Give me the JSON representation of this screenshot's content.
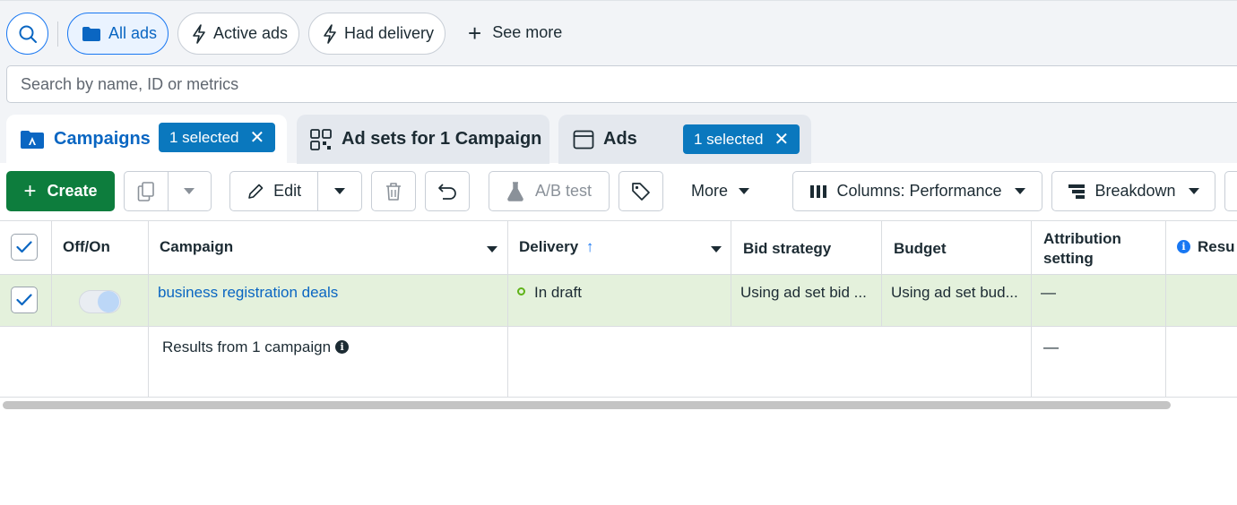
{
  "filters": {
    "all_ads": "All ads",
    "active_ads": "Active ads",
    "had_delivery": "Had delivery",
    "see_more": "See more"
  },
  "search": {
    "placeholder": "Search by name, ID or metrics"
  },
  "tabs": [
    {
      "label": "Campaigns",
      "selected": "1 selected"
    },
    {
      "label": "Ad sets for 1 Campaign"
    },
    {
      "label": "Ads",
      "selected": "1 selected"
    }
  ],
  "toolbar": {
    "create": "Create",
    "edit": "Edit",
    "ab_test": "A/B test",
    "more": "More",
    "columns": "Columns: Performance",
    "breakdown": "Breakdown"
  },
  "table": {
    "headers": {
      "offon": "Off/On",
      "campaign": "Campaign",
      "delivery": "Delivery",
      "bid_strategy": "Bid strategy",
      "budget": "Budget",
      "attribution_1": "Attribution",
      "attribution_2": "setting",
      "results": "Resu"
    },
    "rows": [
      {
        "campaign": "business registration deals",
        "delivery": "In draft",
        "bid_strategy": "Using ad set bid ...",
        "budget": "Using ad set bud...",
        "attribution": "—"
      }
    ],
    "summary": {
      "label": "Results from 1 campaign",
      "attribution": "—"
    }
  },
  "colors": {
    "accent": "#0a66c2",
    "create_green": "#0d7d3d",
    "selected_row": "#e4f1dc",
    "pill": "#0a78be"
  }
}
